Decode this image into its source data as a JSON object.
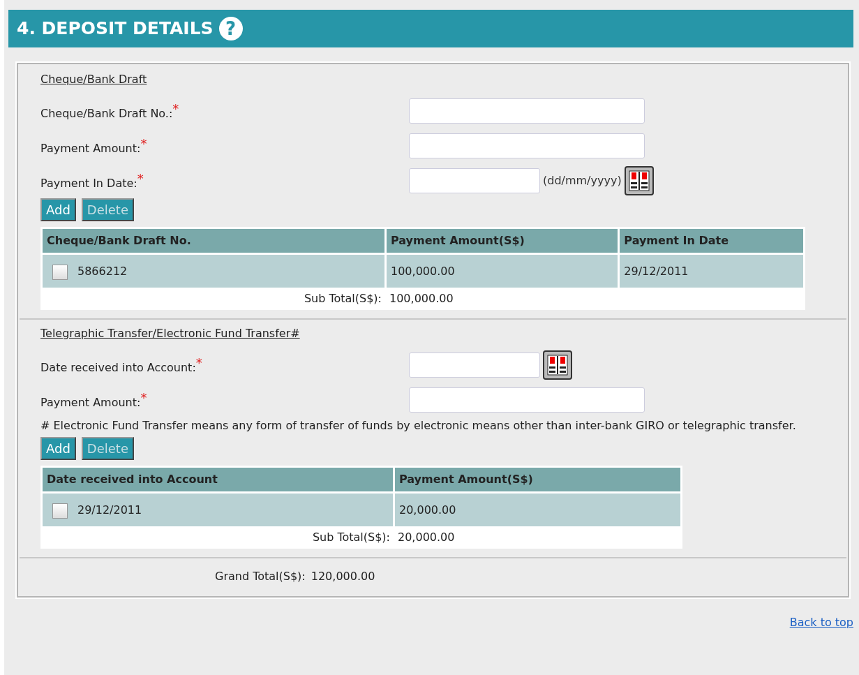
{
  "header": {
    "title": "4. DEPOSIT DETAILS",
    "help_icon": "?"
  },
  "sections": [
    {
      "title": "Cheque/Bank Draft",
      "fields": [
        {
          "kind": "text",
          "label": "Cheque/Bank Draft No.:",
          "required_mark": "*"
        },
        {
          "kind": "text",
          "label": "Payment Amount:",
          "required_mark": "*"
        },
        {
          "kind": "date",
          "label": "Payment In Date:",
          "required_mark": "*",
          "hint": "(dd/mm/yyyy)"
        }
      ],
      "buttons": [
        {
          "label": "Add",
          "disabled": false
        },
        {
          "label": "Delete",
          "disabled": true
        }
      ],
      "table": {
        "columns": [
          "Cheque/Bank Draft No.",
          "Payment Amount(S$)",
          "Payment In Date"
        ],
        "rows": [
          {
            "checked": false,
            "cells": [
              "5866212",
              "100,000.00",
              "29/12/2011"
            ]
          }
        ],
        "subtotal_label": "Sub Total(S$):",
        "subtotal_value": "100,000.00"
      }
    },
    {
      "title": "Telegraphic Transfer/Electronic Fund Transfer#",
      "fields": [
        {
          "kind": "date",
          "label": "Date received into Account:",
          "required_mark": "*"
        },
        {
          "kind": "text",
          "label": "Payment Amount:",
          "required_mark": "*"
        }
      ],
      "note": "# Electronic Fund Transfer means any form of transfer of funds by electronic means other than inter-bank GIRO or telegraphic transfer.",
      "buttons": [
        {
          "label": "Add",
          "disabled": false
        },
        {
          "label": "Delete",
          "disabled": true
        }
      ],
      "table": {
        "columns": [
          "Date received into Account",
          "Payment Amount(S$)"
        ],
        "rows": [
          {
            "checked": false,
            "cells": [
              "29/12/2011",
              "20,000.00"
            ]
          }
        ],
        "subtotal_label": "Sub Total(S$):",
        "subtotal_value": "20,000.00"
      }
    }
  ],
  "grand_total": {
    "label": "Grand Total(S$):",
    "value": "120,000.00"
  },
  "back_to_top": "Back to top"
}
